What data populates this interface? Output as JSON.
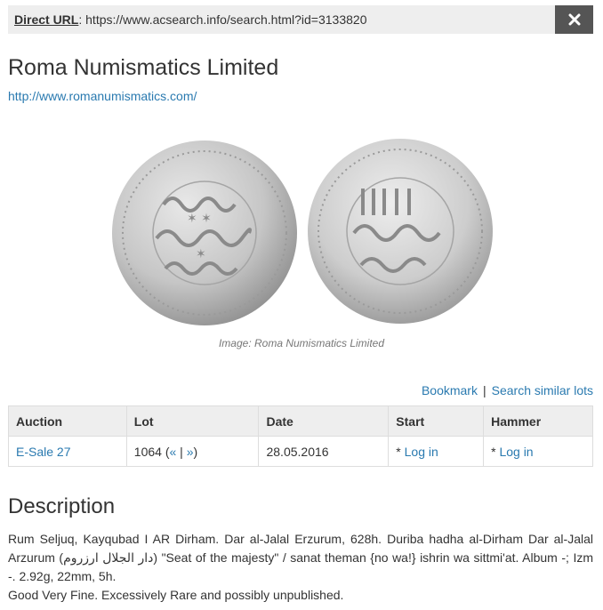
{
  "direct_url": {
    "label": "Direct URL",
    "value": ": https://www.acsearch.info/search.html?id=3133820"
  },
  "close_icon": "close-icon",
  "seller": {
    "name": "Roma Numismatics Limited",
    "url": "http://www.romanumismatics.com/"
  },
  "image": {
    "caption": "Image: Roma Numismatics Limited"
  },
  "actions": {
    "bookmark": "Bookmark",
    "separator": "|",
    "similar": "Search similar lots"
  },
  "table": {
    "headers": [
      "Auction",
      "Lot",
      "Date",
      "Start",
      "Hammer"
    ],
    "row": {
      "auction": "E-Sale 27",
      "lot_number": "1064 (",
      "lot_prev": "«",
      "lot_sep": " | ",
      "lot_next": "»",
      "lot_close": ")",
      "date": "28.05.2016",
      "start_prefix": "* ",
      "start_link": "Log in",
      "hammer_prefix": "* ",
      "hammer_link": "Log in"
    }
  },
  "description": {
    "title": "Description",
    "text": "Rum Seljuq, Kayqubad I AR Dirham. Dar al-Jalal Erzurum, 628h. Duriba hadha al-Dirham Dar al-Jalal Arzurum (دار الجلال ارزروم) \"Seat of the majesty\" / sanat theman {no wa!} ishrin wa sittmi'at. Album -; Izm -. 2.92g, 22mm, 5h.",
    "grade": "Good Very Fine. Excessively Rare and possibly unpublished."
  },
  "colors": {
    "link": "#2a7ab0",
    "bar_bg": "#eeeeee",
    "close_bg": "#555555",
    "coin_silver": "#c9c9c9"
  }
}
